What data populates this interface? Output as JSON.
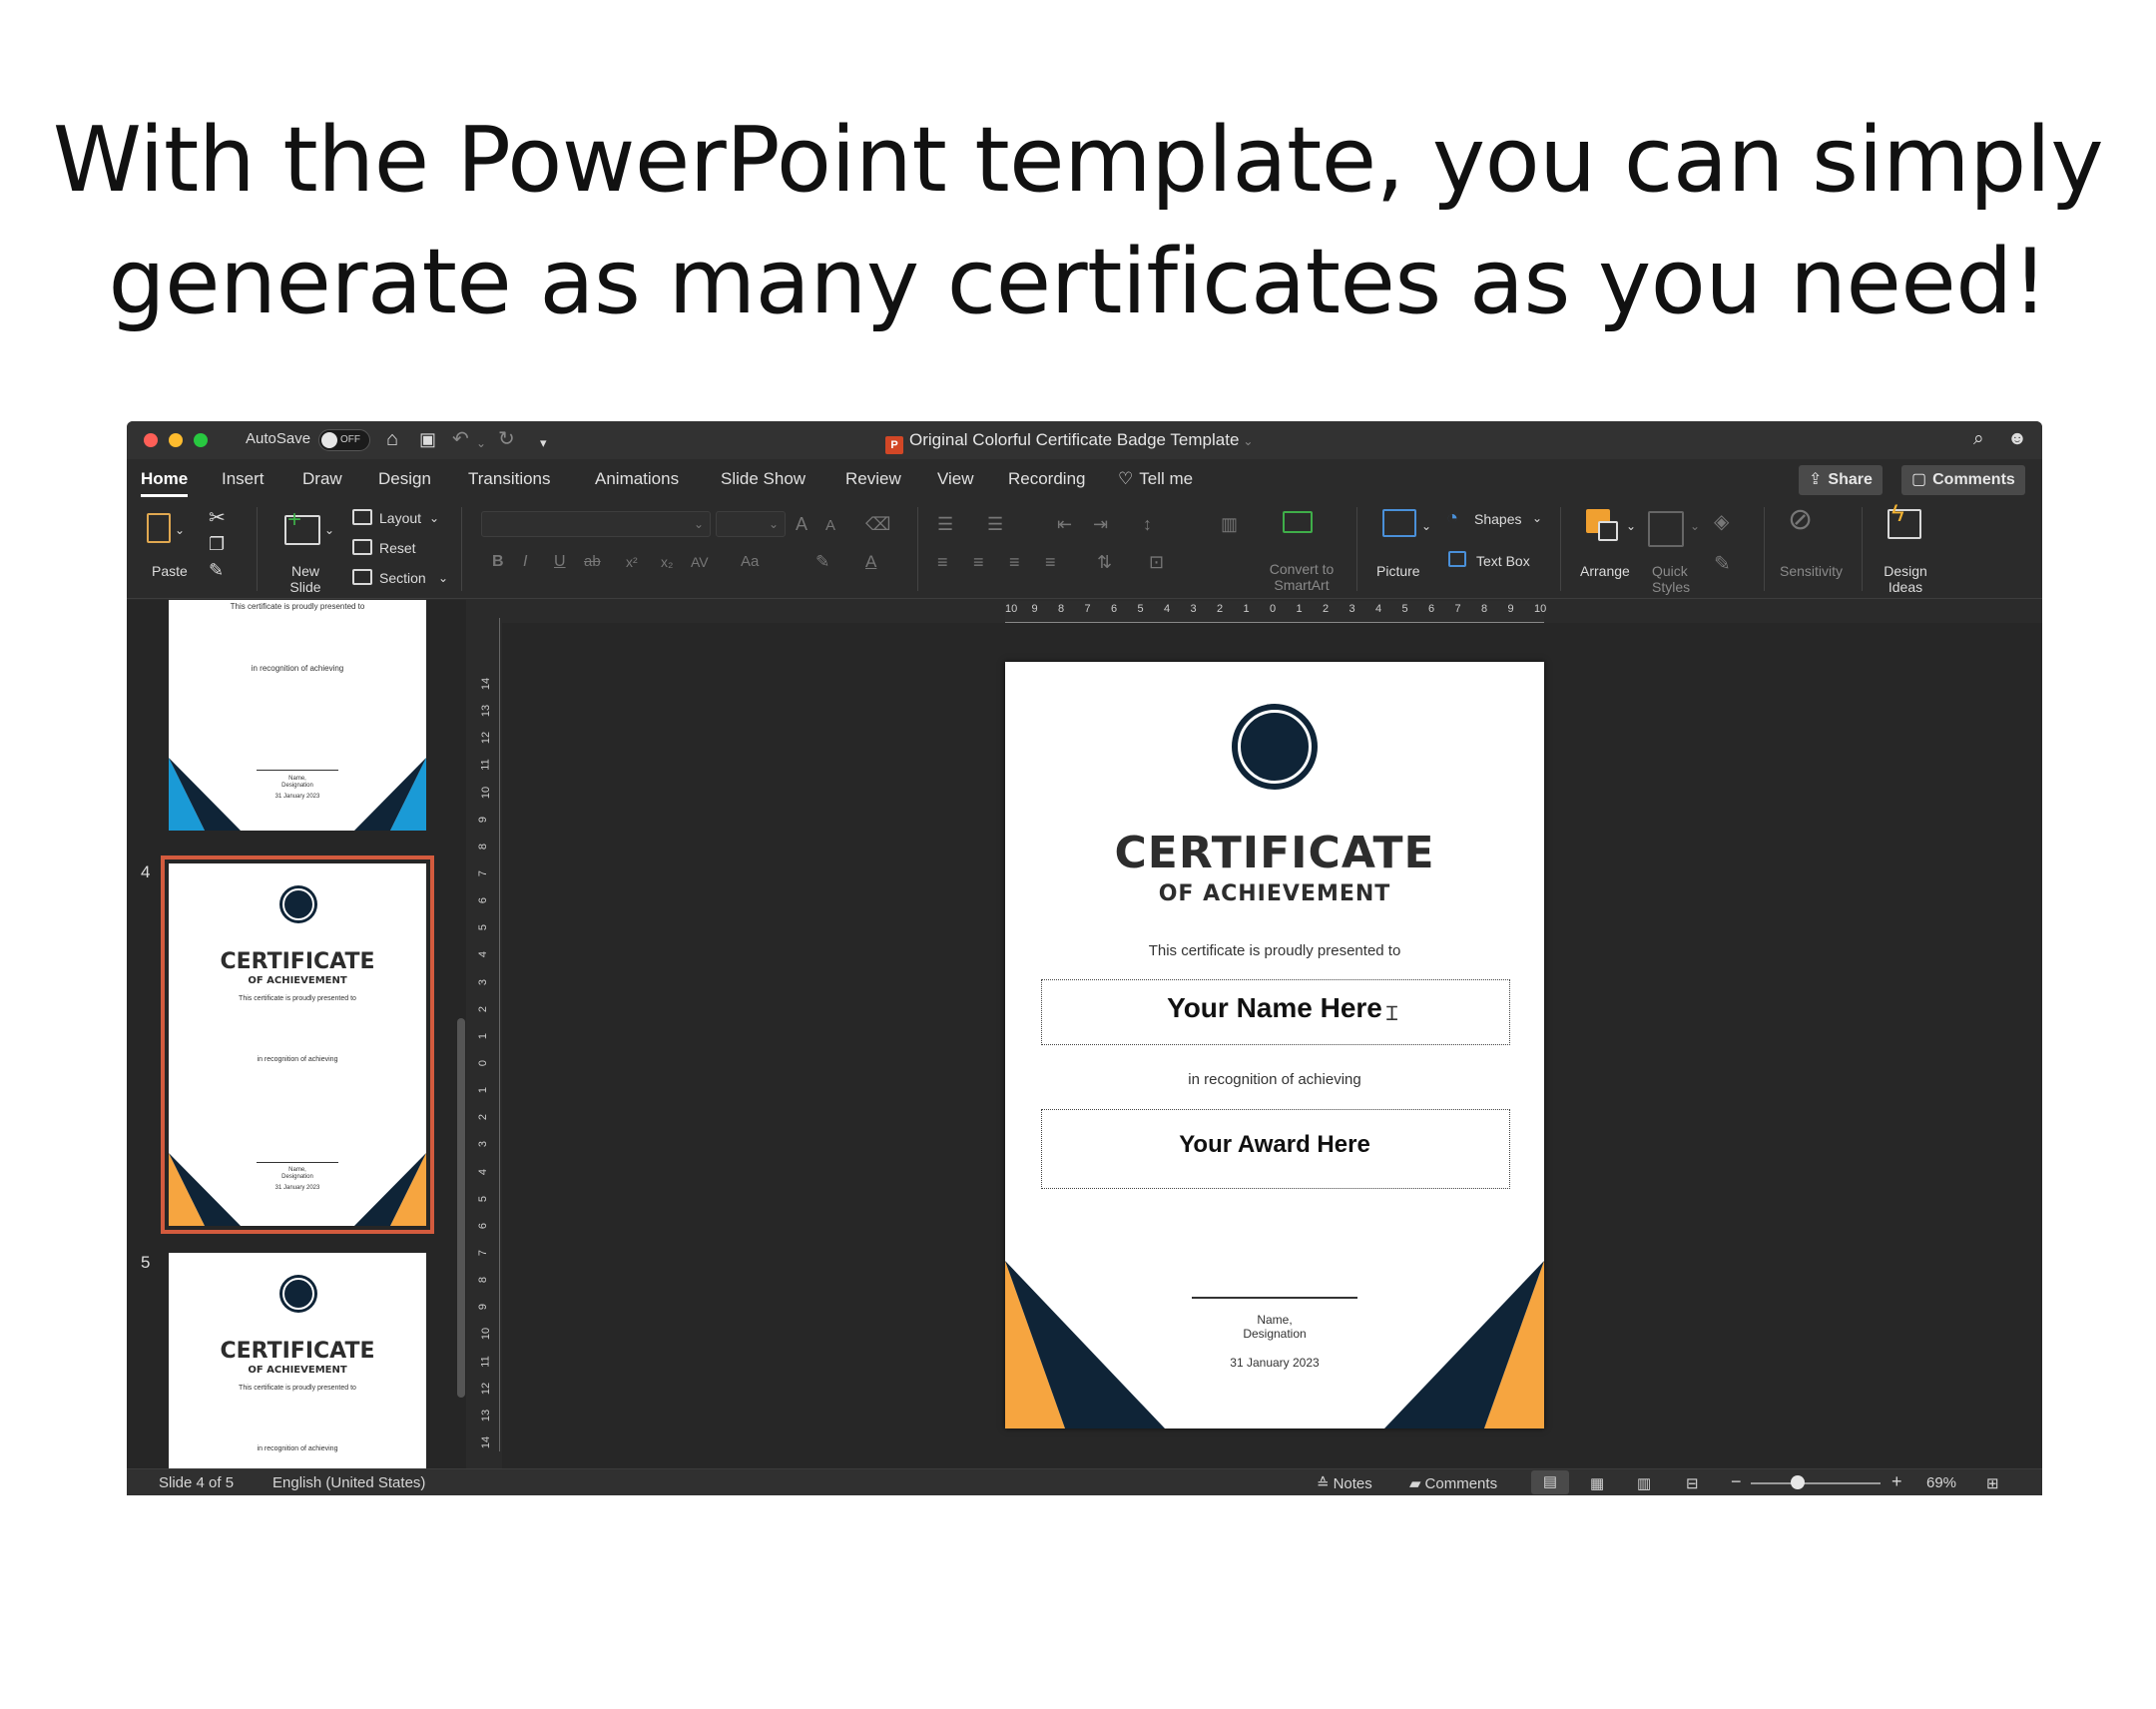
{
  "headline": {
    "line1": "With the PowerPoint template, you can simply",
    "line2": "generate as many certificates as you need!"
  },
  "titlebar": {
    "autosave_label": "AutoSave",
    "autosave_state": "OFF",
    "document_title": "Original Colorful Certificate Badge Template"
  },
  "tabs": [
    "Home",
    "Insert",
    "Draw",
    "Design",
    "Transitions",
    "Animations",
    "Slide Show",
    "Review",
    "View",
    "Recording",
    "Tell me"
  ],
  "active_tab": "Home",
  "share_label": "Share",
  "comments_label": "Comments",
  "ribbon": {
    "paste": "Paste",
    "new_slide": "New Slide",
    "layout": "Layout",
    "reset": "Reset",
    "section": "Section",
    "bold": "B",
    "italic": "I",
    "underline": "U",
    "strike": "ab",
    "superscript": "x²",
    "subscript": "x₂",
    "spacing": "AV",
    "change_case": "Aa",
    "grow_font": "A",
    "shrink_font": "A",
    "convert_smartart": "Convert to SmartArt",
    "picture": "Picture",
    "shapes": "Shapes",
    "text_box": "Text Box",
    "arrange": "Arrange",
    "quick_styles": "Quick Styles",
    "sensitivity": "Sensitivity",
    "design_ideas": "Design Ideas"
  },
  "thumbnails": {
    "slide3": {
      "presented": "This certificate is proudly presented to",
      "recognition": "in recognition of achieving",
      "name": "Name,",
      "designation": "Designation",
      "date": "31 January 2023",
      "accent": "#1a9ad6"
    },
    "slide4": {
      "number": "4",
      "title": "CERTIFICATE",
      "subtitle": "OF ACHIEVEMENT",
      "presented": "This certificate is proudly presented to",
      "recognition": "in recognition of achieving",
      "name": "Name,",
      "designation": "Designation",
      "date": "31 January 2023",
      "accent": "#f6a540"
    },
    "slide5": {
      "number": "5",
      "title": "CERTIFICATE",
      "subtitle": "OF ACHIEVEMENT",
      "presented": "This certificate is proudly presented to",
      "recognition": "in recognition of achieving"
    }
  },
  "ruler": {
    "horizontal": [
      "10",
      "9",
      "8",
      "7",
      "6",
      "5",
      "4",
      "3",
      "2",
      "1",
      "0",
      "1",
      "2",
      "3",
      "4",
      "5",
      "6",
      "7",
      "8",
      "9",
      "10"
    ],
    "vertical": [
      "14",
      "13",
      "12",
      "11",
      "10",
      "9",
      "8",
      "7",
      "6",
      "5",
      "4",
      "3",
      "2",
      "1",
      "0",
      "1",
      "2",
      "3",
      "4",
      "5",
      "6",
      "7",
      "8",
      "9",
      "10",
      "11",
      "12",
      "13",
      "14"
    ]
  },
  "slide": {
    "title": "CERTIFICATE",
    "subtitle": "OF ACHIEVEMENT",
    "presented": "This certificate is proudly presented to",
    "name_placeholder": "Your Name Here",
    "recognition": "in recognition of achieving",
    "award_placeholder": "Your Award Here",
    "sign_name": "Name,",
    "sign_designation": "Designation",
    "date": "31 January 2023",
    "colors": {
      "navy": "#0f2437",
      "accent": "#f6a540"
    }
  },
  "status": {
    "slide_info": "Slide 4 of 5",
    "language": "English (United States)",
    "notes": "Notes",
    "comments": "Comments",
    "zoom": "69%"
  },
  "colors": {
    "window_bg": "#2b2b2b",
    "selection_outline": "#d35b3e"
  }
}
